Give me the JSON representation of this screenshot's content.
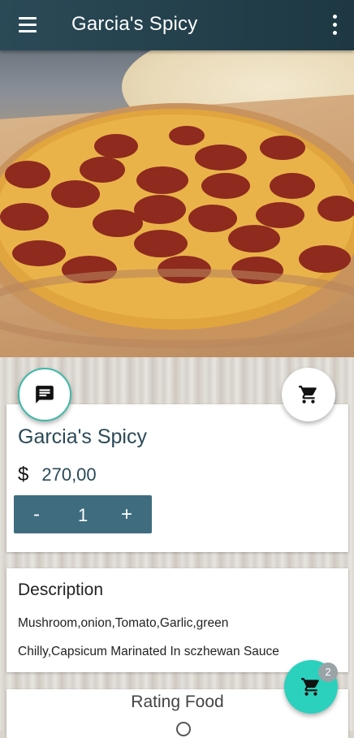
{
  "appbar": {
    "title": "Garcia's Spicy",
    "menu_icon": "menu-icon",
    "more_icon": "more-vertical-icon"
  },
  "hero": {
    "image": "pepperoni-pizza-photo"
  },
  "actions": {
    "chat_icon": "chat-icon",
    "cart_icon": "add-to-cart-icon"
  },
  "product": {
    "name": "Garcia's Spicy",
    "currency": "$",
    "price": "270,00",
    "quantity": "1",
    "minus_label": "-",
    "plus_label": "+"
  },
  "description": {
    "title": "Description",
    "line1": "Mushroom,onion,Tomato,Garlic,green",
    "line2": "Chilly,Capsicum Marinated In sczhewan Sauce"
  },
  "rating": {
    "title": "Rating Food"
  },
  "cart": {
    "count": "2",
    "icon": "cart-icon"
  },
  "colors": {
    "primary": "#2b4a57",
    "accent": "#2bd1bd",
    "stepper": "#3f6d7f"
  }
}
